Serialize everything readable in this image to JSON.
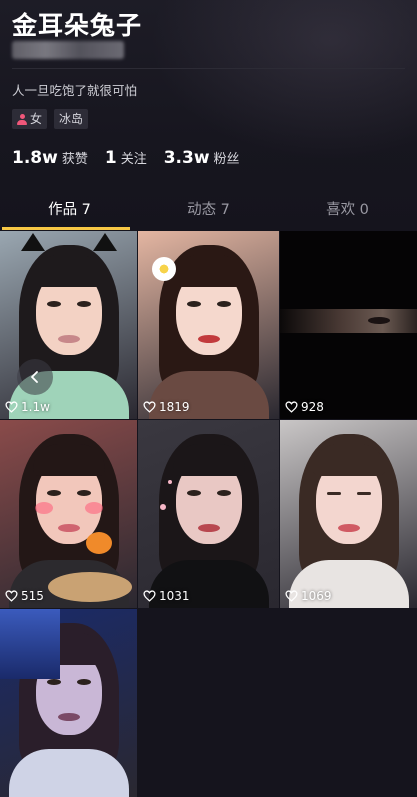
{
  "profile": {
    "nickname": "金耳朵兔子",
    "bio": "人一旦吃饱了就很可怕",
    "tags": {
      "gender": "女",
      "region": "冰岛"
    }
  },
  "stats": [
    {
      "value": "1.8w",
      "label": "获赞"
    },
    {
      "value": "1",
      "label": "关注"
    },
    {
      "value": "3.3w",
      "label": "粉丝"
    }
  ],
  "tabs": [
    {
      "label": "作品 7",
      "active": true
    },
    {
      "label": "动态 7",
      "active": false
    },
    {
      "label": "喜欢 0",
      "active": false
    }
  ],
  "videos": [
    {
      "likes": "1.1w",
      "palette": {
        "bg": "#9aa7b1",
        "skin": "#f3d2c4",
        "hair": "#1e1a1c",
        "lips": "#c7878a",
        "shirt": "#9fd3b9"
      },
      "features": [
        "cat-ears",
        "back-button"
      ]
    },
    {
      "likes": "1819",
      "palette": {
        "bg": "#e4b6a2",
        "skin": "#f5d8cd",
        "hair": "#2a1814",
        "lips": "#c23a3c",
        "shirt": "#6a4a42"
      },
      "features": [
        "flower"
      ]
    },
    {
      "likes": "928",
      "palette": {
        "bg": "#060506",
        "skin": "#6b5b55",
        "hair": "#0a0808",
        "lips": "#3a2a28",
        "shirt": "#0b0b0c"
      },
      "features": [
        "dark"
      ]
    },
    {
      "likes": "515",
      "palette": {
        "bg": "#8a4b4a",
        "skin": "#f2c7bb",
        "hair": "#231716",
        "lips": "#d06470",
        "shirt": "#2c2a2e"
      },
      "features": [
        "blush",
        "food"
      ]
    },
    {
      "likes": "1031",
      "palette": {
        "bg": "#3a3840",
        "skin": "#e9c8c4",
        "hair": "#1b1618",
        "lips": "#b8474f",
        "shirt": "#111113"
      },
      "features": [
        "sparkles"
      ]
    },
    {
      "likes": "1069",
      "palette": {
        "bg": "#c9c6c6",
        "skin": "#f3d6cf",
        "hair": "#3a2a24",
        "lips": "#d05a63",
        "shirt": "#e8e4e2"
      },
      "features": [
        "closed-eyes"
      ]
    },
    {
      "likes": "",
      "palette": {
        "bg": "#1a2a6a",
        "skin": "#c9b7d6",
        "hair": "#2a1e2a",
        "lips": "#7a4a66",
        "shirt": "#cfd3e6"
      },
      "features": [
        "car"
      ]
    }
  ],
  "icons": {
    "heart": "heart-outline-icon",
    "gender": "female-user-icon",
    "back": "chevron-left-icon"
  },
  "colors": {
    "background": "#15141d",
    "tab_indicator": "#f7c845",
    "gender_icon": "#f0577a"
  }
}
